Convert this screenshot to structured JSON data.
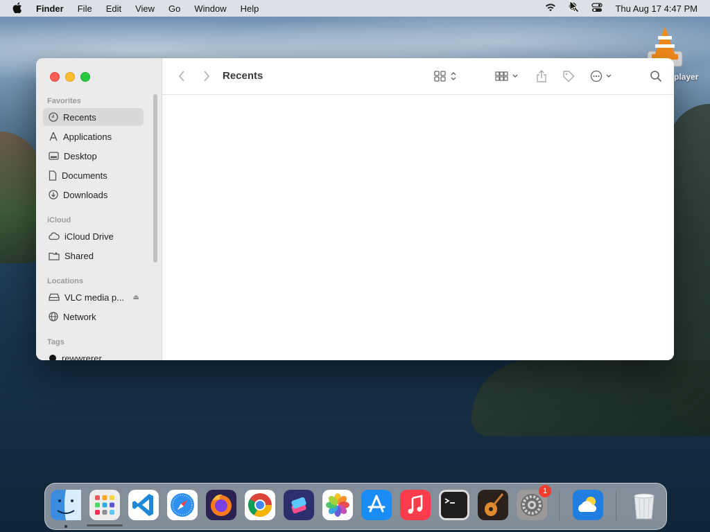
{
  "menubar": {
    "app_name": "Finder",
    "menus": [
      "File",
      "Edit",
      "View",
      "Go",
      "Window",
      "Help"
    ],
    "clock": "Thu Aug 17  4:47 PM"
  },
  "desktop": {
    "icon_label": "player"
  },
  "finder": {
    "title": "Recents",
    "sidebar": {
      "favorites_title": "Favorites",
      "favorites": [
        {
          "label": "Recents",
          "icon": "clock-icon",
          "selected": true
        },
        {
          "label": "Applications",
          "icon": "applications-icon"
        },
        {
          "label": "Desktop",
          "icon": "desktop-icon"
        },
        {
          "label": "Documents",
          "icon": "document-icon"
        },
        {
          "label": "Downloads",
          "icon": "download-icon"
        }
      ],
      "icloud_title": "iCloud",
      "icloud": [
        {
          "label": "iCloud Drive",
          "icon": "cloud-icon"
        },
        {
          "label": "Shared",
          "icon": "shared-folder-icon"
        }
      ],
      "locations_title": "Locations",
      "locations": [
        {
          "label": "VLC media p...",
          "icon": "drive-icon"
        },
        {
          "label": "Network",
          "icon": "globe-icon"
        }
      ],
      "tags_title": "Tags",
      "tags": [
        {
          "label": "rewwrerer",
          "color": "#111111"
        }
      ]
    }
  },
  "dock": {
    "apps": [
      {
        "name": "Finder",
        "icon": "finder-icon",
        "color": "#3a8dde"
      },
      {
        "name": "Launchpad",
        "icon": "launchpad-icon",
        "color": "#e8e8e8"
      },
      {
        "name": "Visual Studio Code",
        "icon": "vscode-icon",
        "color": "#ffffff"
      },
      {
        "name": "Safari",
        "icon": "safari-icon",
        "color": "#2f8ff0"
      },
      {
        "name": "Firefox",
        "icon": "firefox-icon",
        "color": "#3b2a6e"
      },
      {
        "name": "Chrome",
        "icon": "chrome-icon",
        "color": "#ffffff"
      },
      {
        "name": "Shortcuts",
        "icon": "shortcuts-icon",
        "color": "#2b2f6e"
      },
      {
        "name": "Photos",
        "icon": "photos-icon",
        "color": "#ffffff"
      },
      {
        "name": "App Store",
        "icon": "appstore-icon",
        "color": "#1a8cf6"
      },
      {
        "name": "Music",
        "icon": "music-icon",
        "color": "#fa3c4c"
      },
      {
        "name": "Terminal",
        "icon": "terminal-icon",
        "color": "#1e1e1e"
      },
      {
        "name": "GarageBand",
        "icon": "garageband-icon",
        "color": "#3a2a22"
      },
      {
        "name": "System Settings",
        "icon": "settings-icon",
        "color": "#8e8e8e",
        "badge": "1"
      },
      {
        "name": "Weather",
        "icon": "weather-icon",
        "color": "#1f7ee0"
      },
      {
        "name": "Trash",
        "icon": "trash-icon",
        "color": "#dfe3e6"
      }
    ]
  }
}
